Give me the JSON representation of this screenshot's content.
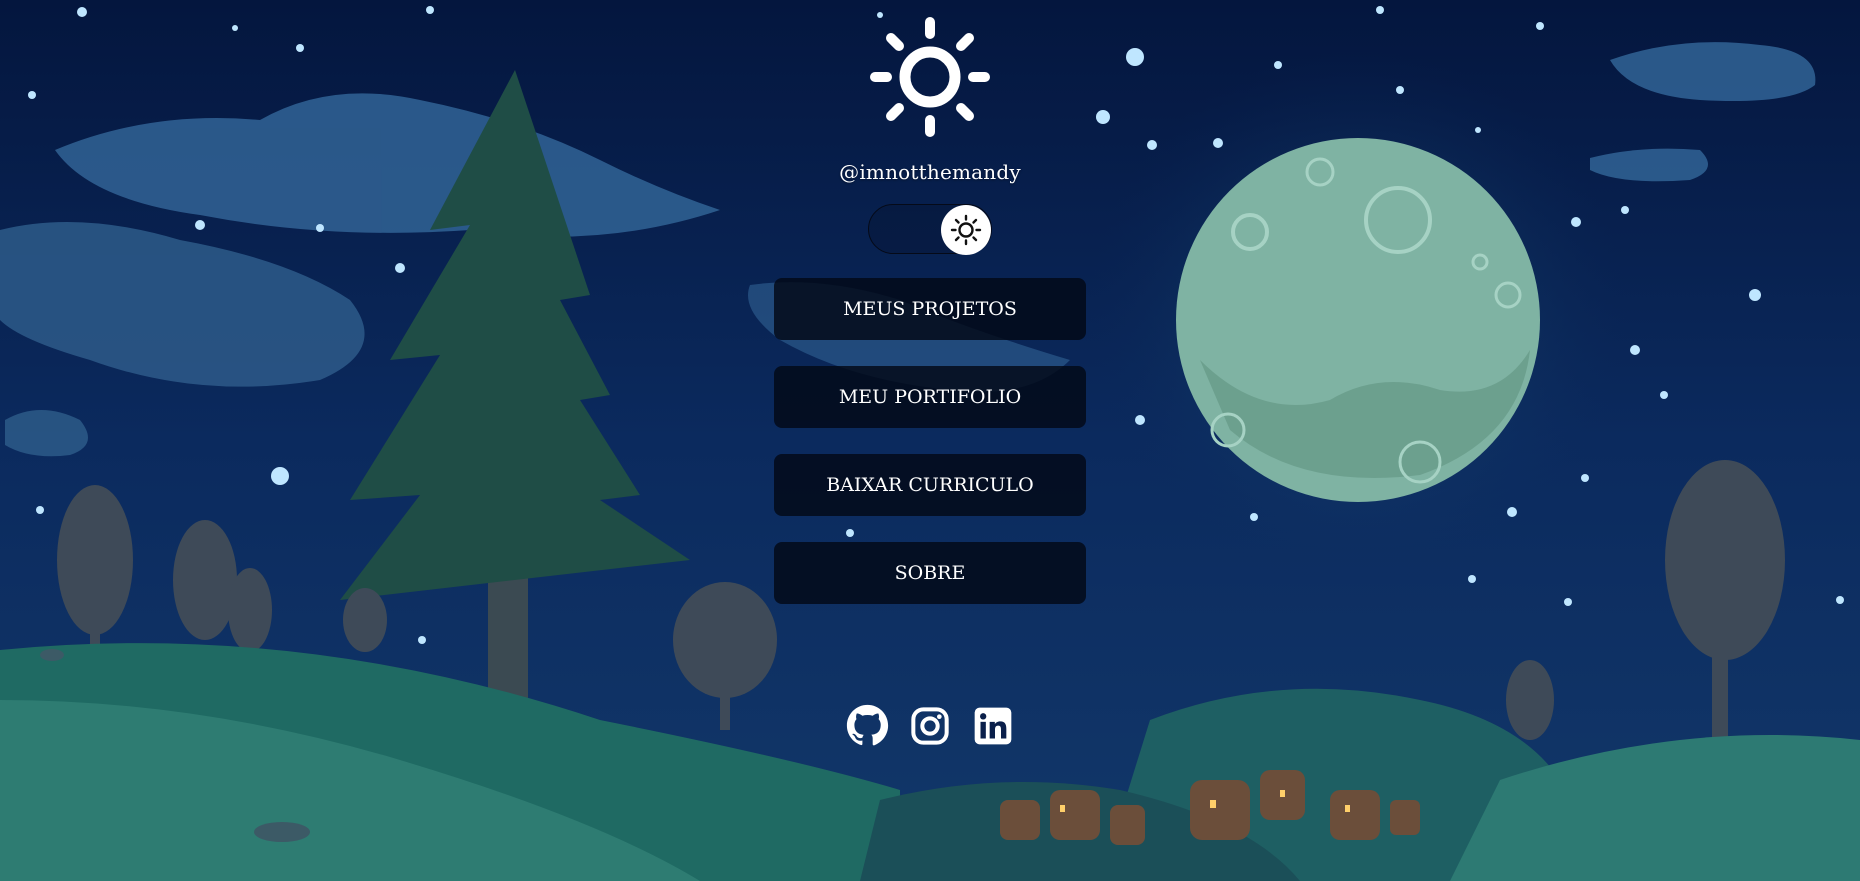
{
  "profile": {
    "handle": "@imnotthemandy"
  },
  "theme_toggle": {
    "icon": "sun-icon",
    "state": "dark"
  },
  "menu": [
    {
      "label": "MEUS PROJETOS"
    },
    {
      "label": "MEU PORTIFOLIO"
    },
    {
      "label": "BAIXAR CURRICULO"
    },
    {
      "label": "SOBRE"
    }
  ],
  "socials": [
    {
      "icon": "github-icon"
    },
    {
      "icon": "instagram-icon"
    },
    {
      "icon": "linkedin-icon"
    }
  ],
  "colors": {
    "sky": "#0a1f4a",
    "moon": "#7fb3a3",
    "button_bg": "#020816",
    "text": "#ffffff"
  }
}
